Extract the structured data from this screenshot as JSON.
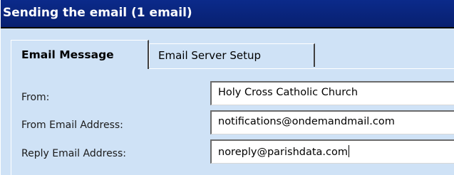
{
  "window": {
    "title": "Sending the email (1 email)"
  },
  "tabs": [
    {
      "label": "Email Message",
      "active": true
    },
    {
      "label": "Email Server Setup",
      "active": false
    }
  ],
  "form": {
    "from": {
      "label": "From:",
      "value": "Holy Cross Catholic Church"
    },
    "from_email": {
      "label": "From Email Address:",
      "value": "notifications@ondemandmail.com"
    },
    "reply_email": {
      "label": "Reply Email Address:",
      "value": "noreply@parishdata.com"
    }
  },
  "colors": {
    "titlebar": "#0b2a8a",
    "panel": "#cfe2f6",
    "field": "#ffffff"
  }
}
